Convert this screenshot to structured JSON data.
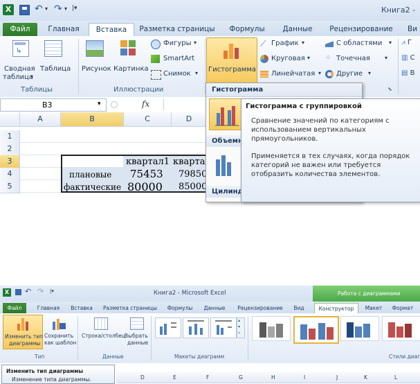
{
  "shot1": {
    "title": "Книга2 -",
    "tabs": [
      "Файл",
      "Главная",
      "Вставка",
      "Разметка страницы",
      "Формулы",
      "Данные",
      "Рецензирование",
      "Ви"
    ],
    "ribbon": {
      "pivot_label_1": "Сводная",
      "pivot_label_2": "таблица",
      "pivot_dropdown": "▾",
      "table_label": "Таблица",
      "group_tables": "Таблицы",
      "picture_label": "Рисунок",
      "clipart_label": "Картинка",
      "shapes_label": "Фигуры",
      "smartart_label": "SmartArt",
      "screenshot_label": "Снимок",
      "group_illustrations": "Иллюстрации",
      "column_label": "Гистограмма",
      "line_label": "График",
      "pie_label": "Круговая",
      "bar_label": "Линейчатая",
      "area_label": "С областями",
      "scatter_label": "Точечная",
      "other_label": "Другие",
      "spark_1": "Г",
      "spark_2": "С",
      "spark_3": "В"
    },
    "formula": {
      "name_box": "B3",
      "fx": "fx"
    },
    "columns": [
      "A",
      "B",
      "C",
      "D"
    ],
    "rows": [
      "1",
      "2",
      "3",
      "4",
      "5"
    ],
    "cells": {
      "c3": "квартал1",
      "d3": "квартал",
      "b4": "плановые",
      "c4": "75453",
      "d4": "79850",
      "b5": "фактические",
      "c5": "80000",
      "d5": "85000"
    },
    "dropdown": {
      "header": "Гистограмма",
      "section2": "Объемн",
      "section3": "Цилинд"
    },
    "tooltip": {
      "title": "Гистограмма с группировкой",
      "p1": [
        "Сравнение значений по категориям с",
        "использованием вертикальных",
        "прямоугольников."
      ],
      "p2": [
        "Применяется в тех случаях, когда порядок",
        "категорий не важен или требуется",
        "отобразить количества элементов."
      ]
    }
  },
  "shot2": {
    "title": "Книга2 - Microsoft Excel",
    "context_title": "Работа с диаграммами",
    "tabs": [
      "Файл",
      "Главная",
      "Вставка",
      "Разметка страницы",
      "Формулы",
      "Данные",
      "Рецензирование",
      "Вид",
      "Конструктор",
      "Макет",
      "Формат"
    ],
    "ribbon": {
      "change_type_1": "Изменить тип",
      "change_type_2": "диаграммы",
      "save_template_1": "Сохранить",
      "save_template_2": "как шаблон",
      "group_type": "Тип",
      "row_col": "Строка/столбец",
      "select_data_1": "Выбрать",
      "select_data_2": "данные",
      "group_data": "Данные",
      "group_layouts": "Макеты диаграмм",
      "group_styles": "Стили диагр"
    },
    "tooltip": {
      "title": "Изменить тип диаграммы",
      "body": "Изменение типа диаграммы."
    },
    "columns": [
      "D",
      "E",
      "F",
      "G",
      "H",
      "I",
      "J",
      "K",
      "L"
    ]
  },
  "colors": {
    "file_tab": "#2c7a2b",
    "context_tab": "#4aa84a",
    "series_blue": "#4f81bd",
    "series_red": "#c0504d",
    "highlight": "#f1cd6a"
  }
}
